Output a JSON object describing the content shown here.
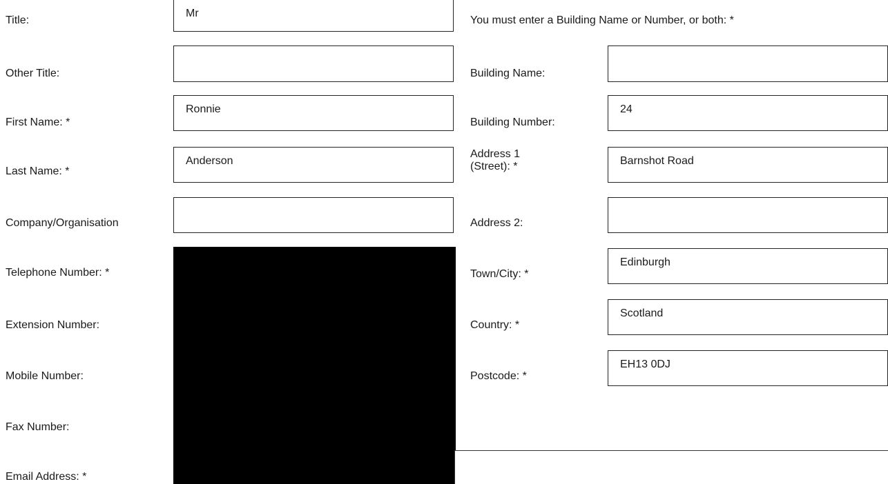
{
  "left": {
    "title_label": "Title:",
    "title_value": "Mr",
    "other_title_label": "Other Title:",
    "other_title_value": "",
    "first_name_label": "First Name: *",
    "first_name_value": "Ronnie",
    "last_name_label": "Last Name: *",
    "last_name_value": "Anderson",
    "company_label": "Company/Organisation",
    "company_value": "",
    "telephone_label": "Telephone Number: *",
    "extension_label": "Extension Number:",
    "mobile_label": "Mobile Number:",
    "fax_label": "Fax Number:",
    "email_label": "Email Address: *"
  },
  "right": {
    "notice": "You must enter a Building Name or Number, or both: *",
    "building_name_label": "Building Name:",
    "building_name_value": "",
    "building_number_label": "Building Number:",
    "building_number_value": "24",
    "address1_label_line1": "Address 1",
    "address1_label_line2": "(Street): *",
    "address1_value": "Barnshot Road",
    "address2_label": "Address 2:",
    "address2_value": "",
    "town_label": "Town/City: *",
    "town_value": "Edinburgh",
    "country_label": "Country: *",
    "country_value": "Scotland",
    "postcode_label": "Postcode: *",
    "postcode_value": "EH13 0DJ"
  },
  "colors": {
    "border": "#222222",
    "redaction": "#000000",
    "text": "#1a1a1a"
  }
}
